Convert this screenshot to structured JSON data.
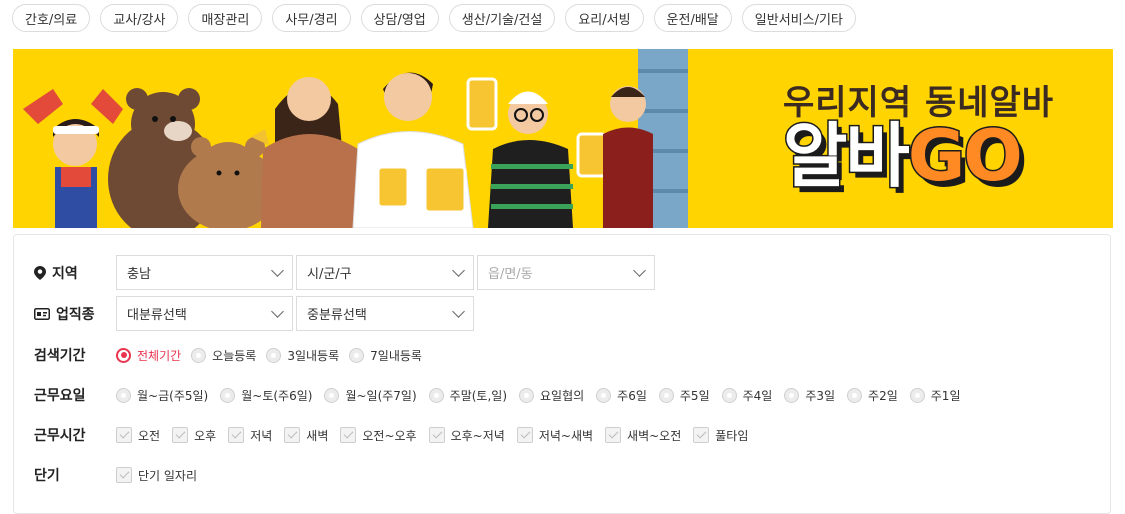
{
  "categories": [
    "간호/의료",
    "교사/강사",
    "매장관리",
    "사무/경리",
    "상담/영업",
    "생산/기술/건설",
    "요리/서빙",
    "운전/배달",
    "일반서비스/기타"
  ],
  "banner": {
    "subtitle": "우리지역 동네알바",
    "title_main": "알바",
    "title_accent": "GO"
  },
  "filters": {
    "region": {
      "label": "지역",
      "province": "충남",
      "city": "시/군/구",
      "town": "읍/면/동"
    },
    "job_type": {
      "label": "업직종",
      "major": "대분류선택",
      "minor": "중분류선택"
    },
    "period": {
      "label": "검색기간",
      "options": [
        "전체기간",
        "오늘등록",
        "3일내등록",
        "7일내등록"
      ],
      "selected": "전체기간"
    },
    "days": {
      "label": "근무요일",
      "options": [
        "월~금(주5일)",
        "월~토(주6일)",
        "월~일(주7일)",
        "주말(토,일)",
        "요일협의",
        "주6일",
        "주5일",
        "주4일",
        "주3일",
        "주2일",
        "주1일"
      ]
    },
    "hours": {
      "label": "근무시간",
      "options": [
        "오전",
        "오후",
        "저녁",
        "새벽",
        "오전~오후",
        "오후~저녁",
        "저녁~새벽",
        "새벽~오전",
        "풀타임"
      ]
    },
    "short_term": {
      "label": "단기",
      "options": [
        "단기 일자리"
      ]
    }
  },
  "colors": {
    "accent": "#e8344e",
    "banner_bg": "#ffd400",
    "banner_accent": "#ff8a23"
  }
}
